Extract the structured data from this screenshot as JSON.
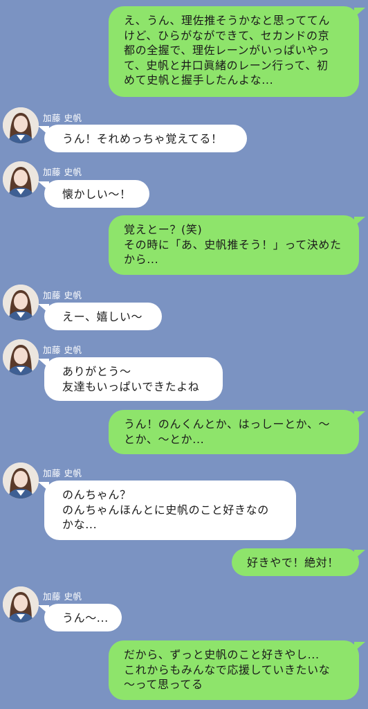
{
  "contact": {
    "name": "加藤 史帆"
  },
  "messages": [
    {
      "side": "me",
      "text": "え、うん、理佐推そうかなと思っててん\nけど、ひらがなができて、セカンドの京\n都の全握で、理佐レーンがいっぱいやっ\nて、史帆と井口眞緒のレーン行って、初\nめて史帆と握手したんよな..."
    },
    {
      "side": "other",
      "name": "加藤 史帆",
      "text": "うん！それめっちゃ覚えてる！"
    },
    {
      "side": "other",
      "name": "加藤 史帆",
      "text": "懐かしい〜！"
    },
    {
      "side": "me",
      "text": "覚えとー？(笑)\nその時に「あ、史帆推そう！」って決めた\nから..."
    },
    {
      "side": "other",
      "name": "加藤 史帆",
      "text": "えー、嬉しい〜"
    },
    {
      "side": "other",
      "name": "加藤 史帆",
      "text": "ありがとう〜\n友達もいっぱいできたよね"
    },
    {
      "side": "me",
      "text": "うん！のんくんとか、はっしーとか、〜\nとか、〜とか..."
    },
    {
      "side": "other",
      "name": "加藤 史帆",
      "text": "のんちゃん？\nのんちゃんほんとに史帆のこと好きなの\nかな..."
    },
    {
      "side": "me",
      "text": "好きやで！絶対！"
    },
    {
      "side": "other",
      "name": "加藤 史帆",
      "text": "うん〜..."
    },
    {
      "side": "me",
      "text": "だから、ずっと史帆のこと好きやし...\nこれからもみんなで応援していきたいな\n〜って思ってる"
    }
  ],
  "colors": {
    "background": "#7b93c2",
    "my_bubble": "#8ee46b",
    "other_bubble": "#ffffff"
  }
}
